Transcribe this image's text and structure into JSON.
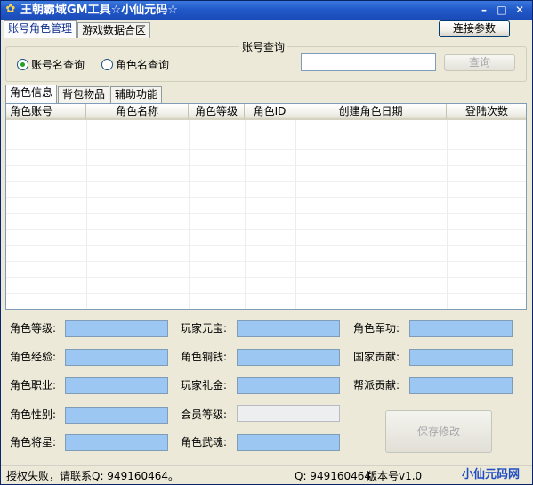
{
  "window": {
    "title": "王朝霸域GM工具☆小仙元码☆",
    "icon": "app-icon",
    "controls": {
      "minimize": "–",
      "maximize": "□",
      "close": "✕"
    }
  },
  "top_tabs": [
    {
      "label": "账号角色管理",
      "active": true
    },
    {
      "label": "游戏数据合区",
      "active": false
    }
  ],
  "connect_button": "连接参数",
  "account_query": {
    "legend": "账号查询",
    "radio_account": "账号名查询",
    "radio_role": "角色名查询",
    "selected": "account",
    "input_value": "",
    "query_button": "查询"
  },
  "inner_tabs": [
    {
      "label": "角色信息",
      "active": true
    },
    {
      "label": "背包物品",
      "active": false
    },
    {
      "label": "辅助功能",
      "active": false
    }
  ],
  "table": {
    "columns": [
      "角色账号",
      "角色名称",
      "角色等级",
      "角色ID",
      "创建角色日期",
      "登陆次数"
    ],
    "rows": []
  },
  "fields": {
    "col1": [
      "角色等级:",
      "角色经验:",
      "角色职业:",
      "角色性别:",
      "角色将星:"
    ],
    "col2": [
      "玩家元宝:",
      "角色铜钱:",
      "玩家礼金:",
      "会员等级:",
      "角色武魂:"
    ],
    "col3": [
      "角色军功:",
      "国家贡献:",
      "帮派贡献:"
    ]
  },
  "save_button": "保存修改",
  "status": {
    "left": "授权失败，请联系Q: 949160464。",
    "qq": "Q: 949160464",
    "version": "版本号v1.0",
    "watermark": "小仙元码网"
  },
  "colors": {
    "titlebar": "#2259c9",
    "field_fill": "#9cc7f3",
    "window_bg": "#ece9d8"
  }
}
